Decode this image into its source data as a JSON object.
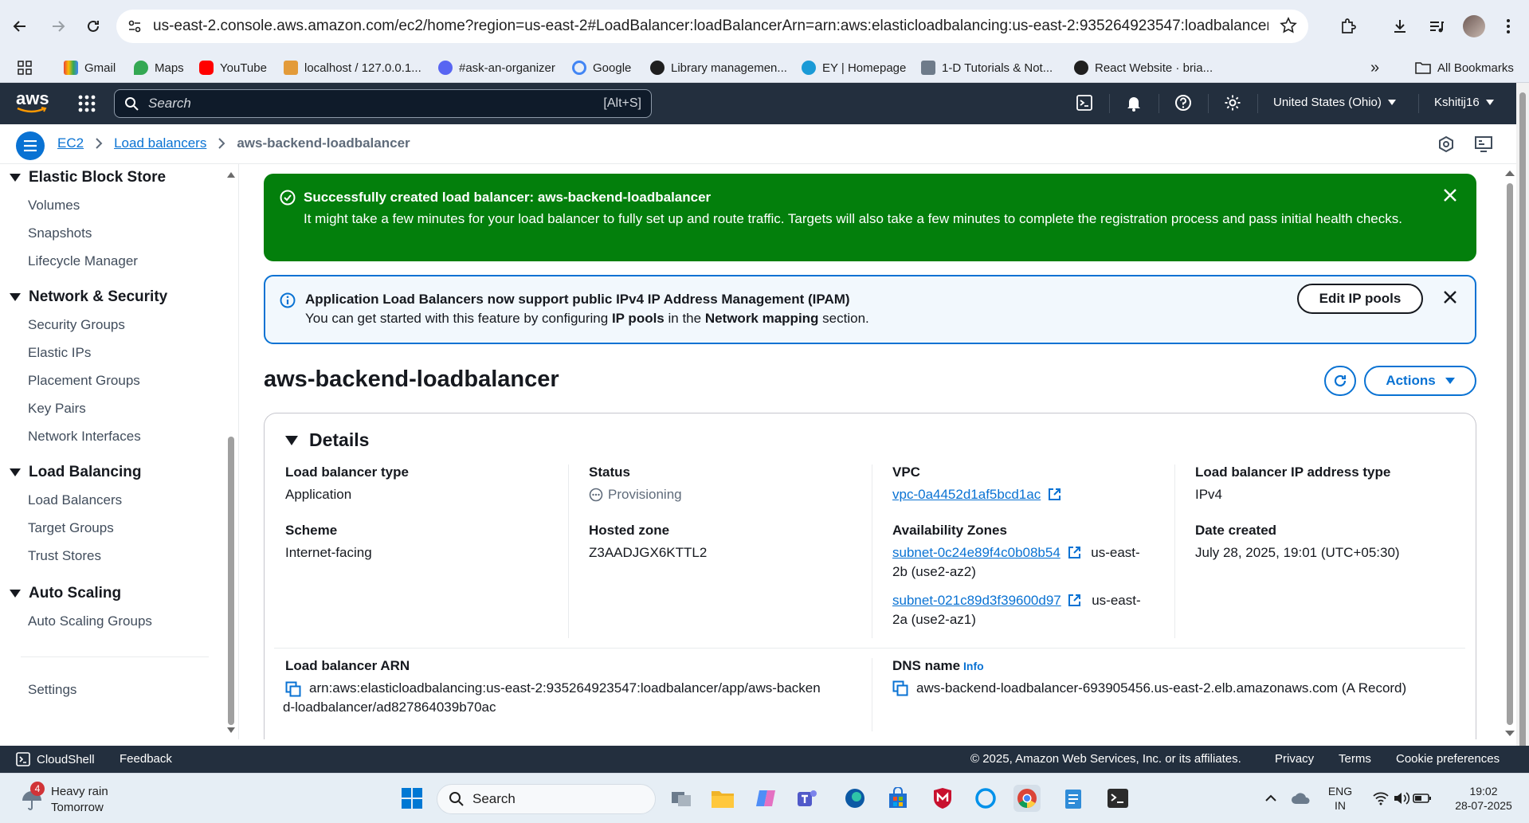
{
  "browser": {
    "url": "us-east-2.console.aws.amazon.com/ec2/home?region=us-east-2#LoadBalancer:loadBalancerArn=arn:aws:elasticloadbalancing:us-east-2:935264923547:loadbalancer/app/aws-backe...",
    "bookmarks": [
      "Gmail",
      "Maps",
      "YouTube",
      "localhost / 127.0.0.1...",
      "#ask-an-organizer",
      "Google",
      "Library managemen...",
      "EY | Homepage",
      "1-D Tutorials & Not...",
      "React Website · bria..."
    ],
    "all_bookmarks": "All Bookmarks",
    "more": "»"
  },
  "awsnav": {
    "logo": "aws",
    "search_placeholder": "Search",
    "search_shortcut": "[Alt+S]",
    "region": "United States (Ohio)",
    "user": "Kshitij16"
  },
  "breadcrumb": {
    "items": [
      "EC2",
      "Load balancers"
    ],
    "current": "aws-backend-loadbalancer"
  },
  "sidebar": {
    "sections": [
      {
        "title": "Elastic Block Store",
        "items": [
          "Volumes",
          "Snapshots",
          "Lifecycle Manager"
        ]
      },
      {
        "title": "Network & Security",
        "items": [
          "Security Groups",
          "Elastic IPs",
          "Placement Groups",
          "Key Pairs",
          "Network Interfaces"
        ]
      },
      {
        "title": "Load Balancing",
        "items": [
          "Load Balancers",
          "Target Groups",
          "Trust Stores"
        ]
      },
      {
        "title": "Auto Scaling",
        "items": [
          "Auto Scaling Groups"
        ]
      }
    ],
    "settings": "Settings"
  },
  "flash_success": {
    "title_prefix": "Successfully created load balancer: ",
    "title_name": "aws-backend-loadbalancer",
    "message": "It might take a few minutes for your load balancer to fully set up and route traffic. Targets will also take a few minutes to complete the registration process and pass initial health checks."
  },
  "flash_info": {
    "title": "Application Load Balancers now support public IPv4 IP Address Management (IPAM)",
    "msg_a": "You can get started with this feature by configuring ",
    "msg_b": "IP pools",
    "msg_c": " in the ",
    "msg_d": "Network mapping",
    "msg_e": " section.",
    "button": "Edit IP pools"
  },
  "page": {
    "title": "aws-backend-loadbalancer",
    "actions": "Actions"
  },
  "details": {
    "heading": "Details",
    "lb_type_label": "Load balancer type",
    "lb_type": "Application",
    "scheme_label": "Scheme",
    "scheme": "Internet-facing",
    "status_label": "Status",
    "status": "Provisioning",
    "hosted_zone_label": "Hosted zone",
    "hosted_zone": "Z3AADJGX6KTTL2",
    "vpc_label": "VPC",
    "vpc": "vpc-0a4452d1af5bcd1ac",
    "az_label": "Availability Zones",
    "az1_subnet": "subnet-0c24e89f4c0b08b54",
    "az1_zone_a": "us-east-",
    "az1_zone_b": "2b (use2-az2)",
    "az2_subnet": "subnet-021c89d3f39600d97",
    "az2_zone_a": "us-east-",
    "az2_zone_b": "2a (use2-az1)",
    "ip_type_label": "Load balancer IP address type",
    "ip_type": "IPv4",
    "date_label": "Date created",
    "date": "July 28, 2025, 19:01 (UTC+05:30)",
    "arn_label": "Load balancer ARN",
    "arn_a": "arn:aws:elasticloadbalancing:us-east-2:935264923547:loadbalancer/app/aws-backen",
    "arn_b": "d-loadbalancer/ad827864039b70ac",
    "dns_label": "DNS name",
    "dns_info": "Info",
    "dns": "aws-backend-loadbalancer-693905456.us-east-2.elb.amazonaws.com (A Record)"
  },
  "footer": {
    "cloudshell": "CloudShell",
    "feedback": "Feedback",
    "copyright": "© 2025, Amazon Web Services, Inc. or its affiliates.",
    "privacy": "Privacy",
    "terms": "Terms",
    "cookies": "Cookie preferences"
  },
  "taskbar": {
    "weather_badge": "4",
    "weather_title": "Heavy rain",
    "weather_sub": "Tomorrow",
    "search": "Search",
    "lang_a": "ENG",
    "lang_b": "IN",
    "time": "19:02",
    "date": "28-07-2025"
  },
  "colors": {
    "aws_nav": "#232f3e",
    "link": "#0972d3",
    "success": "#037f0c"
  }
}
